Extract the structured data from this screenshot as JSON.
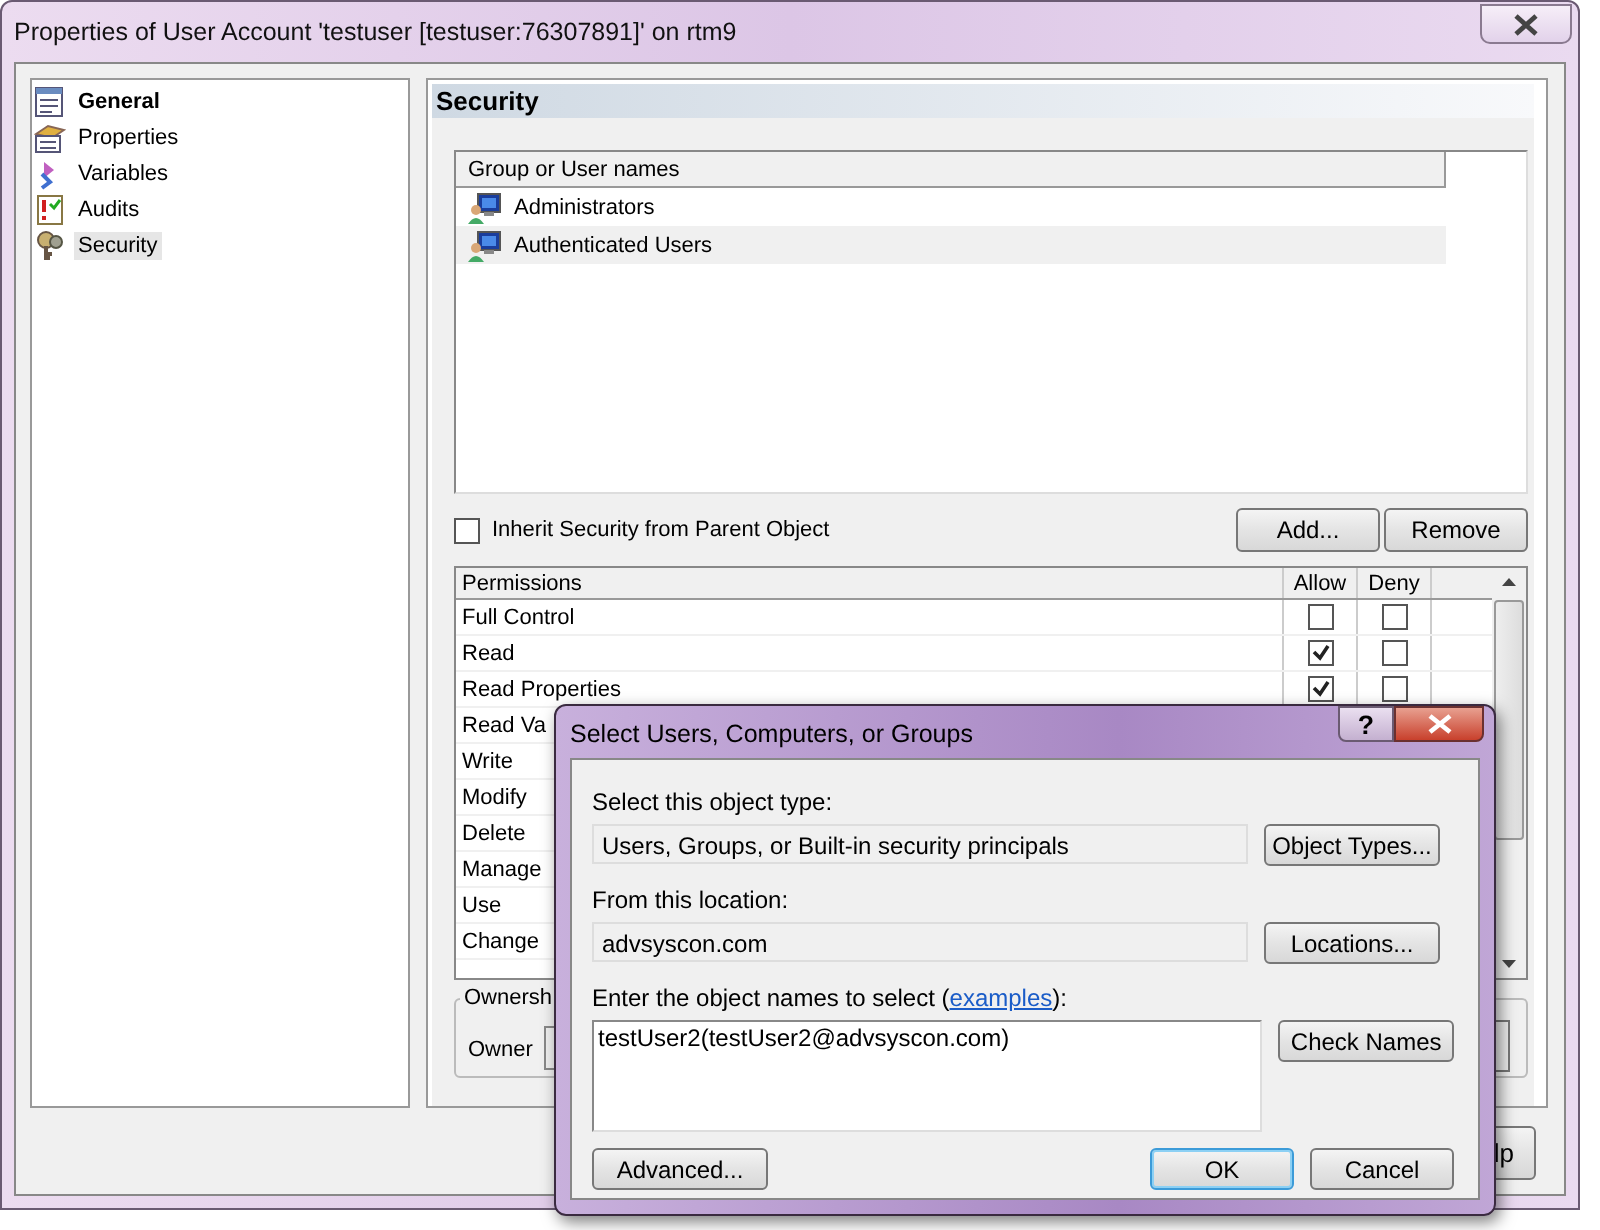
{
  "window": {
    "title": "Properties of User Account 'testuser [testuser:76307891]' on rtm9"
  },
  "nav": {
    "items": [
      {
        "label": "General",
        "kind": "root",
        "selected": false
      },
      {
        "label": "Properties",
        "kind": "properties",
        "selected": false
      },
      {
        "label": "Variables",
        "kind": "variables",
        "selected": false
      },
      {
        "label": "Audits",
        "kind": "audits",
        "selected": false
      },
      {
        "label": "Security",
        "kind": "security",
        "selected": true
      }
    ]
  },
  "security": {
    "heading": "Security",
    "groups": {
      "column": "Group or User names",
      "rows": [
        {
          "name": "Administrators",
          "selected": false
        },
        {
          "name": "Authenticated Users",
          "selected": true
        }
      ]
    },
    "inherit": {
      "label": "Inherit Security from Parent Object",
      "checked": false
    },
    "buttons": [
      "Add...",
      "Remove"
    ],
    "permissions": {
      "columns": [
        "Permissions",
        "Allow",
        "Deny"
      ],
      "rows": [
        {
          "name": "Full Control",
          "allow": false,
          "deny": false
        },
        {
          "name": "Read",
          "allow": true,
          "deny": false
        },
        {
          "name": "Read Properties",
          "allow": true,
          "deny": false
        },
        {
          "name": "Read Va"
        },
        {
          "name": "Write"
        },
        {
          "name": "Modify"
        },
        {
          "name": "Delete"
        },
        {
          "name": "Manage"
        },
        {
          "name": "Use"
        },
        {
          "name": "Change"
        }
      ]
    },
    "ownership": {
      "legend": "Ownersh",
      "owner_label": "Owner"
    }
  },
  "footer": {
    "help_button": "lp"
  },
  "dialog": {
    "title": "Select Users, Computers, or Groups",
    "help": "?",
    "object_type": {
      "label": "Select this object type:",
      "value": "Users, Groups, or Built-in security principals",
      "button": "Object Types..."
    },
    "location": {
      "label": "From this location:",
      "value": "advsyscon.com",
      "button": "Locations..."
    },
    "names": {
      "label_start": "Enter the object names to select (",
      "link": "examples",
      "label_end": "):",
      "value": "testUser2(testUser2@advsyscon.com)",
      "button": "Check Names"
    },
    "advanced_button": "Advanced...",
    "buttons": [
      {
        "label": "OK",
        "default": true
      },
      {
        "label": "Cancel",
        "default": false
      }
    ]
  }
}
